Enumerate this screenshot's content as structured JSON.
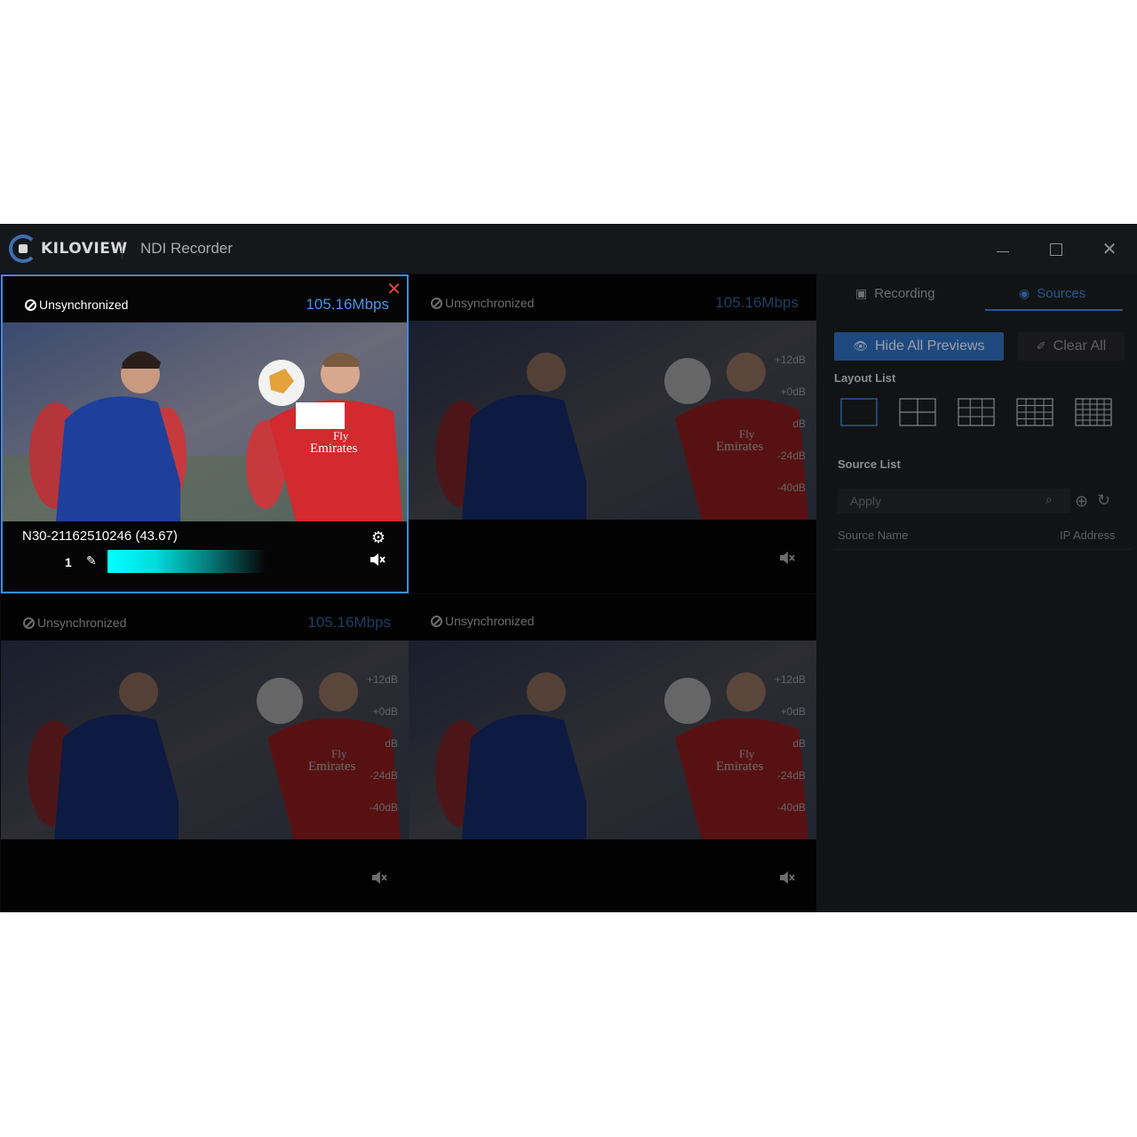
{
  "window": {
    "brand": "KILOVIEW",
    "title": "NDI Recorder",
    "controls": {
      "minimize": "minimize-icon",
      "maximize": "maximize-icon",
      "close": "close-icon"
    }
  },
  "previews": [
    {
      "status": "Unsynchronized",
      "bitrate": "105.16Mbps",
      "source_name": "N30-21162510246 (43.67)",
      "channel": "1",
      "selected": true
    },
    {
      "status": "Unsynchronized",
      "bitrate": "105.16Mbps",
      "source_name": "",
      "channel": "",
      "selected": false
    },
    {
      "status": "Unsynchronized",
      "bitrate": "105.16Mbps",
      "source_name": "",
      "channel": "",
      "selected": false
    },
    {
      "status": "Unsynchronized",
      "bitrate": "",
      "source_name": "",
      "channel": "",
      "selected": false
    }
  ],
  "db_scale": [
    "+12dB",
    "+0dB",
    "dB",
    "-24dB",
    "-40dB"
  ],
  "sidebar": {
    "tabs": [
      {
        "label": "Recording",
        "icon": "recording-icon",
        "active": false
      },
      {
        "label": "Sources",
        "icon": "sources-icon",
        "active": true
      }
    ],
    "hide_all_previews": "Hide All Previews",
    "clear_all": "Clear All",
    "layout_list_label": "Layout List",
    "layouts": [
      "1x1",
      "2x2",
      "3x3",
      "4x4",
      "5x5"
    ],
    "source_list_label": "Source List",
    "search_placeholder": "Apply",
    "columns": {
      "name": "Source Name",
      "ip": "IP Address"
    }
  },
  "colors": {
    "accent": "#3a8ee8",
    "bitrate": "#4a93e6",
    "close": "#e4453a",
    "meter": "#00ffff"
  }
}
